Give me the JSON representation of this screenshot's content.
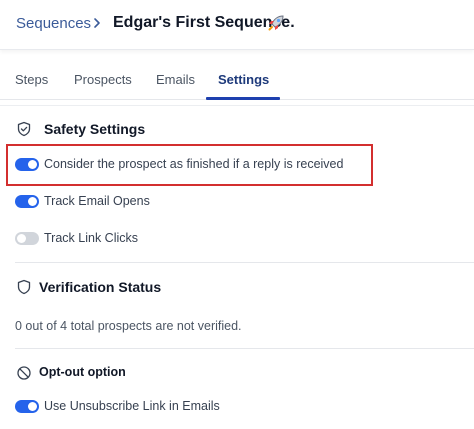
{
  "breadcrumb": {
    "parent": "Sequences",
    "current": "Edgar's First Sequence."
  },
  "tabs": [
    {
      "label": "Steps",
      "active": false
    },
    {
      "label": "Prospects",
      "active": false
    },
    {
      "label": "Emails",
      "active": false
    },
    {
      "label": "Settings",
      "active": true
    }
  ],
  "safety": {
    "title": "Safety Settings",
    "icon": "shield-check-icon",
    "options": [
      {
        "label": "Consider the prospect as finished if a reply is received",
        "enabled": true
      },
      {
        "label": "Track Email Opens",
        "enabled": true
      },
      {
        "label": "Track Link Clicks",
        "enabled": false
      }
    ]
  },
  "verification": {
    "title": "Verification Status",
    "icon": "shield-icon",
    "text": "0 out of 4 total prospects are not verified."
  },
  "optout": {
    "title": "Opt-out option",
    "icon": "block-icon",
    "options": [
      {
        "label": "Use Unsubscribe Link in Emails",
        "enabled": true
      }
    ]
  },
  "colors": {
    "accent": "#2563eb",
    "link": "#3b5b99",
    "highlight_border": "#d32f2f"
  }
}
